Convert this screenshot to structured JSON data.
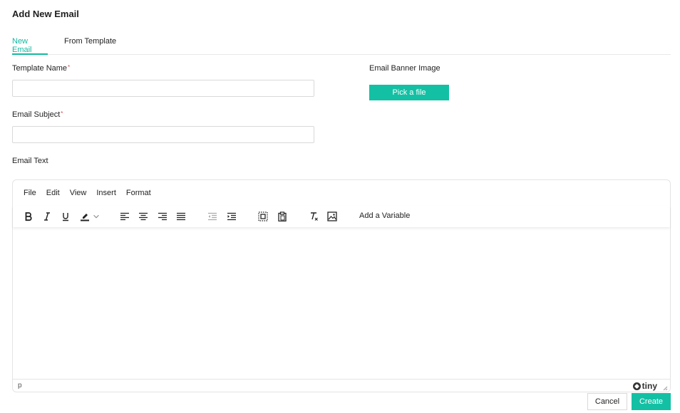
{
  "page": {
    "title": "Add New Email"
  },
  "tabs": [
    {
      "label": "New Email",
      "active": true
    },
    {
      "label": "From Template",
      "active": false
    }
  ],
  "form": {
    "template_name": {
      "label": "Template Name",
      "required_mark": "*",
      "value": "",
      "placeholder": ""
    },
    "email_subject": {
      "label": "Email Subject",
      "required_mark": "*",
      "value": "",
      "placeholder": ""
    },
    "email_text": {
      "label": "Email Text"
    },
    "banner": {
      "label": "Email Banner Image",
      "button_label": "Pick a file"
    }
  },
  "editor": {
    "menu": [
      "File",
      "Edit",
      "View",
      "Insert",
      "Format"
    ],
    "toolbar_icons": [
      "bold-icon",
      "italic-icon",
      "underline-icon",
      "highlight-icon",
      "chevron-down-icon",
      "align-left-icon",
      "align-center-icon",
      "align-right-icon",
      "align-justify-icon",
      "outdent-icon",
      "indent-icon",
      "select-all-icon",
      "paste-icon",
      "clear-format-icon",
      "image-icon"
    ],
    "add_variable_label": "Add a Variable",
    "status_path": "p",
    "brand": "tiny"
  },
  "actions": {
    "cancel_label": "Cancel",
    "create_label": "Create"
  },
  "colors": {
    "accent": "#14c0a4",
    "tab_active": "#14b8a0",
    "required": "#e0454b"
  }
}
